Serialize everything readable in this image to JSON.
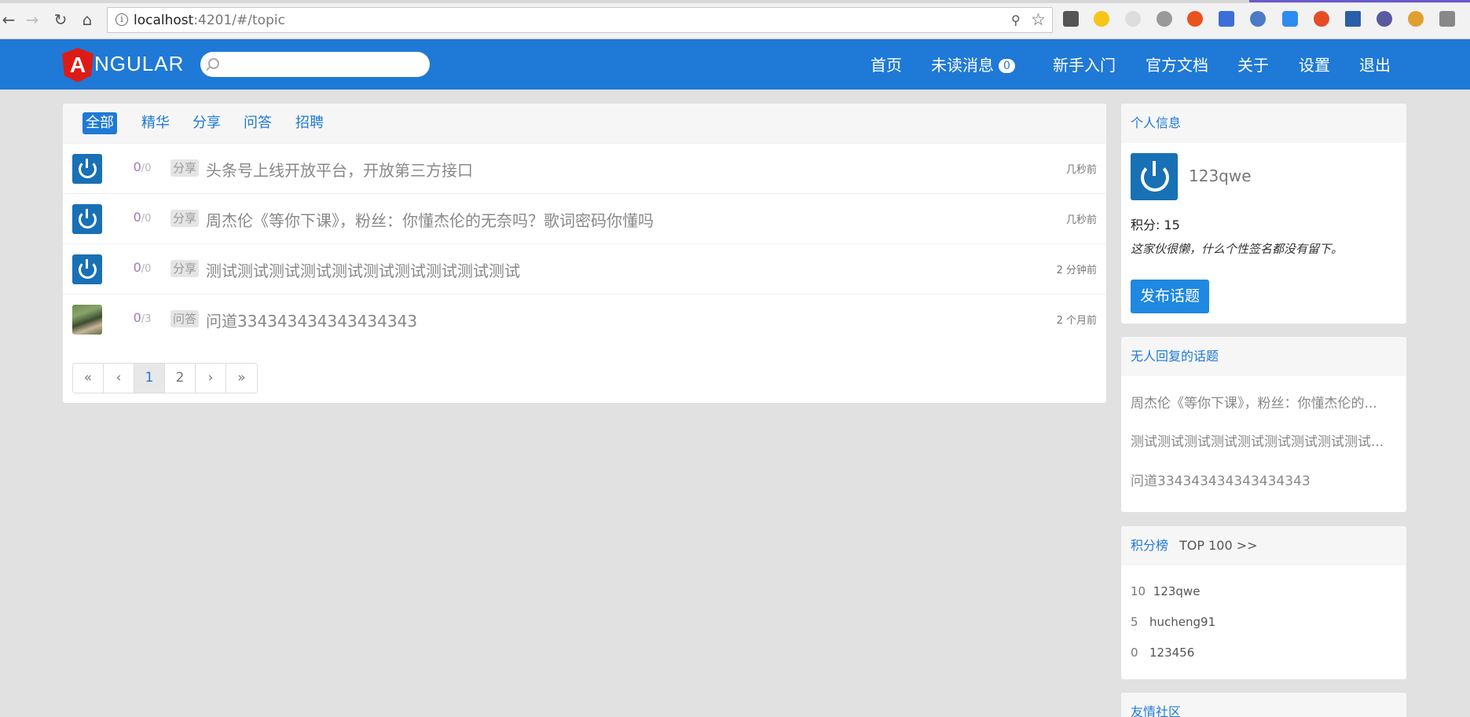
{
  "browser": {
    "url_host": "localhost",
    "url_path": ":4201/#/topic"
  },
  "header": {
    "logo_letter": "A",
    "logo_text": "NGULAR",
    "search_placeholder": "",
    "nav": [
      {
        "label": "首页"
      },
      {
        "label": "未读消息",
        "badge": "0"
      },
      {
        "label": "新手入门"
      },
      {
        "label": "官方文档"
      },
      {
        "label": "关于"
      },
      {
        "label": "设置"
      },
      {
        "label": "退出"
      }
    ]
  },
  "main": {
    "tabs": [
      {
        "label": "全部",
        "active": true
      },
      {
        "label": "精华"
      },
      {
        "label": "分享"
      },
      {
        "label": "问答"
      },
      {
        "label": "招聘"
      }
    ],
    "topics": [
      {
        "replies": "0",
        "visits": "0",
        "tag": "分享",
        "title": "头条号上线开放平台，开放第三方接口",
        "time": "几秒前",
        "avatar": "power-avatar"
      },
      {
        "replies": "0",
        "visits": "0",
        "tag": "分享",
        "title": "周杰伦《等你下课》，粉丝：你懂杰伦的无奈吗？歌词密码你懂吗",
        "time": "几秒前",
        "avatar": "power-avatar"
      },
      {
        "replies": "0",
        "visits": "0",
        "tag": "分享",
        "title": "测试测试测试测试测试测试测试测试测试测试",
        "time": "2 分钟前",
        "avatar": "power-avatar"
      },
      {
        "replies": "0",
        "visits": "3",
        "tag": "问答",
        "title": "问道334343434343434343",
        "time": "2 个月前",
        "avatar": "photo-avatar"
      }
    ],
    "pagination": [
      "«",
      "‹",
      "1",
      "2",
      "›",
      "»"
    ]
  },
  "sidebar": {
    "profile": {
      "heading": "个人信息",
      "username": "123qwe",
      "score": "积分: 15",
      "signature": "这家伙很懒，什么个性签名都没有留下。",
      "publish_label": "发布话题"
    },
    "no_reply": {
      "heading": "无人回复的话题",
      "items": [
        "周杰伦《等你下课》，粉丝：你懂杰伦的...",
        "测试测试测试测试测试测试测试测试测试...",
        "问道334343434343434343"
      ]
    },
    "ranking": {
      "heading": "积分榜",
      "top_link": "TOP 100 >>",
      "rows": [
        {
          "score": "10",
          "name": "123qwe"
        },
        {
          "score": "5",
          "name": "hucheng91"
        },
        {
          "score": "0",
          "name": "123456"
        }
      ]
    },
    "friends": {
      "heading": "友情社区"
    }
  }
}
